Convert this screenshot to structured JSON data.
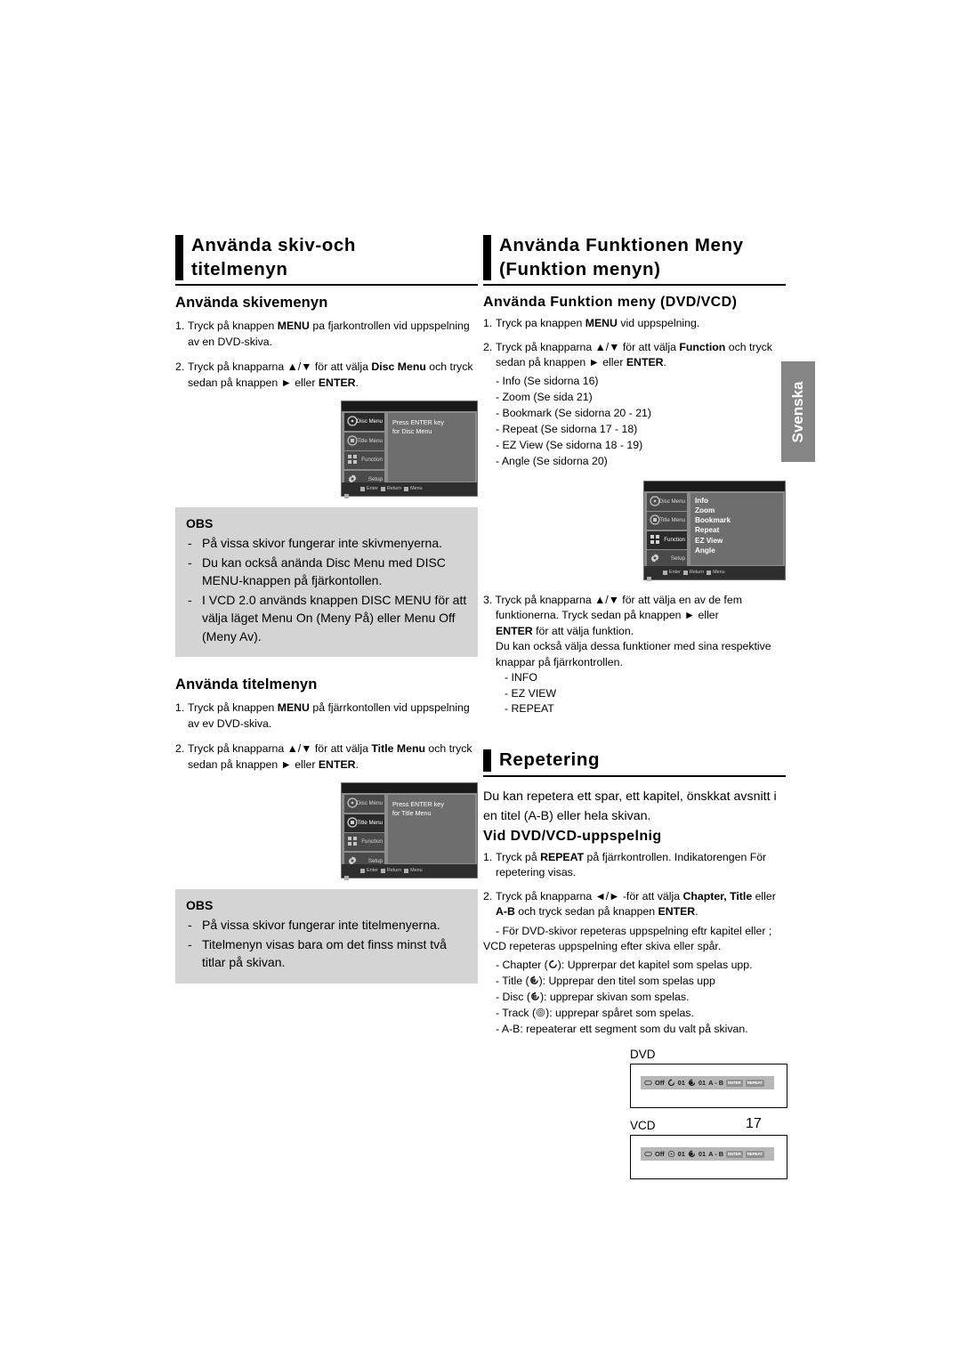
{
  "page": {
    "number": "17",
    "side_tab": "Svenska"
  },
  "left_column": {
    "section_title_line1": "Använda skiv-och",
    "section_title_line2": "titelmenyn",
    "disc_menu": {
      "heading": "Använda skivemenyn",
      "steps": [
        {
          "num": "1.",
          "html": "Tryck på knappen <b>MENU</b> pa fjarkontrollen vid uppspelning av en DVD-skiva."
        },
        {
          "num": "2.",
          "html": "Tryck på knapparna ▲/▼ för att välja <b>Disc Menu</b> och tryck sedan på knappen ► eller <b>ENTER</b>."
        }
      ],
      "tv": {
        "items": [
          {
            "label": "Disc Menu",
            "icon": "disc-menu-icon",
            "selected": true
          },
          {
            "label": "Title Menu",
            "icon": "title-menu-icon",
            "selected": false
          },
          {
            "label": "Function",
            "icon": "function-icon",
            "selected": false
          },
          {
            "label": "Setup",
            "icon": "setup-gear-icon",
            "selected": false
          }
        ],
        "panel_line1": "Press ENTER key",
        "panel_line2": "for Disc Menu",
        "bottom": [
          "Enter",
          "Return",
          "Menu"
        ]
      },
      "obs": {
        "title": "OBS",
        "items": [
          "På vissa skivor fungerar inte skivmenyerna.",
          "Du kan också anända Disc Menu med DISC MENU-knappen på fjärkontollen.",
          "I VCD 2.0 används knappen DISC MENU för att välja läget Menu On (Meny På) eller Menu Off (Meny Av)."
        ]
      }
    },
    "title_menu": {
      "heading": "Använda titelmenyn",
      "steps": [
        {
          "num": "1.",
          "html": "Tryck på knappen <b>MENU</b> på fjärrkontollen vid uppspelning av ev DVD-skiva."
        },
        {
          "num": "2.",
          "html": "Tryck på knapparna ▲/▼ för att välja <b>Title Menu</b> och tryck sedan på knappen ► eller <b>ENTER</b>."
        }
      ],
      "tv": {
        "items": [
          {
            "label": "Disc Menu",
            "icon": "disc-menu-icon",
            "selected": false
          },
          {
            "label": "Title Menu",
            "icon": "title-menu-icon",
            "selected": true
          },
          {
            "label": "Function",
            "icon": "function-icon",
            "selected": false
          },
          {
            "label": "Setup",
            "icon": "setup-gear-icon",
            "selected": false
          }
        ],
        "panel_line1": "Press ENTER key",
        "panel_line2": "for Title Menu",
        "bottom": [
          "Enter",
          "Return",
          "Menu"
        ]
      },
      "obs": {
        "title": "OBS",
        "items": [
          "På vissa skivor fungerar inte titelmenyerna.",
          "Titelmenyn visas bara om det finss minst två titlar på skivan."
        ]
      }
    }
  },
  "right_column": {
    "section_title_line1": "Använda Funktionen Meny",
    "section_title_line2": "(Funktion menyn)",
    "function_menu": {
      "heading": "Använda Funktion meny (DVD/VCD)",
      "step1": {
        "num": "1.",
        "html": "Tryck pa knappen <b>MENU</b> vid uppspelning."
      },
      "step2": {
        "num": "2.",
        "html": "Tryck på knapparna ▲/▼ för att välja <b>Function</b> och tryck sedan på knappen ► eller <b>ENTER</b>."
      },
      "bullets": [
        "- Info (Se sidorna 16)",
        "- Zoom (Se sida 21)",
        "- Bookmark (Se sidorna 20 - 21)",
        "- Repeat (Se sidorna 17 - 18)",
        "- EZ View (Se sidorna 18 - 19)",
        "- Angle  (Se sidorna 20)"
      ],
      "tv": {
        "items": [
          {
            "label": "Disc Menu",
            "icon": "disc-menu-icon",
            "selected": false
          },
          {
            "label": "Title Menu",
            "icon": "title-menu-icon",
            "selected": false
          },
          {
            "label": "Function",
            "icon": "function-icon",
            "selected": true
          },
          {
            "label": "Setup",
            "icon": "setup-gear-icon",
            "selected": false
          }
        ],
        "menu_items": [
          "Info",
          "Zoom",
          "Bookmark",
          "Repeat",
          "EZ View",
          "Angle"
        ],
        "bottom": [
          "Enter",
          "Return",
          "Menu"
        ]
      },
      "step3": {
        "num": "3.",
        "l1": "Tryck på knapparna ▲/▼ för att välja en av de fem",
        "l2": "funktionerna. Tryck sedan på knappen ► eller",
        "l3_bold": "ENTER",
        "l3_rest": " för att välja funktion.",
        "l4": "Du kan också välja dessa funktioner med sina respektive",
        "l5": "knappar på fjärrkontrollen.",
        "l6": "- INFO",
        "l7": "- EZ VIEW",
        "l8": "- REPEAT"
      }
    },
    "repeat": {
      "section_title": "Repetering",
      "intro_l1": "Du kan repetera ett spar, ett kapitel, önskkat avsnitt i",
      "intro_l2": "en titel (A-B) eller hela skivan.",
      "heading": "Vid DVD/VCD-uppspelnig",
      "step1": {
        "num": "1.",
        "html": "Tryck på <b>REPEAT</b> på fjärrkontrollen. Indikatorengen För repetering visas."
      },
      "step2": {
        "num": "2.",
        "html": "Tryck på knapparna ◄/► -för att välja <b>Chapter, Title</b> eller <b>A-B</b> och tryck sedan på knappen <b>ENTER</b>."
      },
      "note_l1": "- För DVD-skivor repeteras uppspelning eftr kapitel eller ;",
      "note_l2": "VCD repeteras uppspelning efter skiva eller spår.",
      "defs": [
        {
          "pre": "- Chapter (",
          "icon": "chapter-repeat-icon",
          "post": "): Upprerpar det kapitel som spelas upp."
        },
        {
          "pre": "- Title (",
          "icon": "title-repeat-icon",
          "post": "): Upprepar den titel som spelas upp"
        },
        {
          "pre": "- Disc (",
          "icon": "disc-repeat-icon",
          "post": "): upprepar skivan som spelas."
        },
        {
          "pre": "- Track (",
          "icon": "track-repeat-icon",
          "post": "): upprepar spåret som spelas."
        },
        {
          "pre": "- A-B: repeaterar ett segment som du valt på skivan.",
          "icon": "",
          "post": ""
        }
      ],
      "osd": [
        {
          "label": "DVD",
          "fields": [
            "Off",
            "01",
            "01",
            "A - B"
          ],
          "keys": [
            "ENTER",
            "REPEAT"
          ]
        },
        {
          "label": "VCD",
          "fields": [
            "Off",
            "01",
            "01",
            "A - B"
          ],
          "keys": [
            "ENTER",
            "REPEAT"
          ]
        }
      ]
    }
  }
}
